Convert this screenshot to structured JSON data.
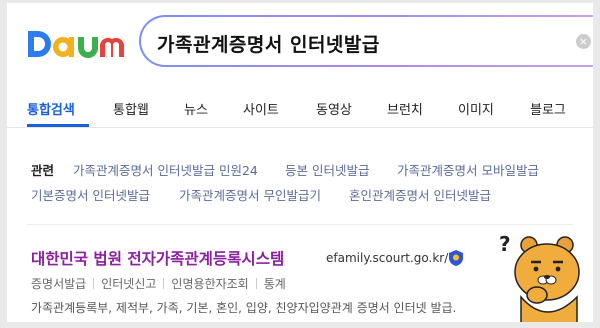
{
  "header": {
    "logo_text": "Daum",
    "search_value": "가족관계증명서 인터넷발급",
    "clear_icon": "×"
  },
  "tabs": [
    {
      "label": "통합검색",
      "active": true
    },
    {
      "label": "통합웹"
    },
    {
      "label": "뉴스"
    },
    {
      "label": "사이트"
    },
    {
      "label": "동영상"
    },
    {
      "label": "브런치"
    },
    {
      "label": "이미지"
    },
    {
      "label": "블로그"
    }
  ],
  "related": {
    "label": "관련",
    "links": [
      "가족관계증명서 인터넷발급 민원24",
      "등본 인터넷발급",
      "가족관계증명서 모바일발급",
      "기본증명서 인터넷발급",
      "가족관계증명서 무인발급기",
      "혼인관계증명서 인터넷발급"
    ]
  },
  "result": {
    "title": "대한민국 법원 전자가족관계등록시스템",
    "url": "efamily.scourt.go.kr/",
    "sublinks": [
      "증명서발급",
      "인터넷신고",
      "인명용한자조회",
      "통계"
    ],
    "snippet": "가족관계등록부, 제적부, 가족, 기본, 혼인, 입양, 친양자입양관계 증명서 인터넷 발급."
  },
  "colors": {
    "accent": "#1a5fd9",
    "result_title": "#8a1fa0",
    "related_link": "#5a6d9a"
  }
}
